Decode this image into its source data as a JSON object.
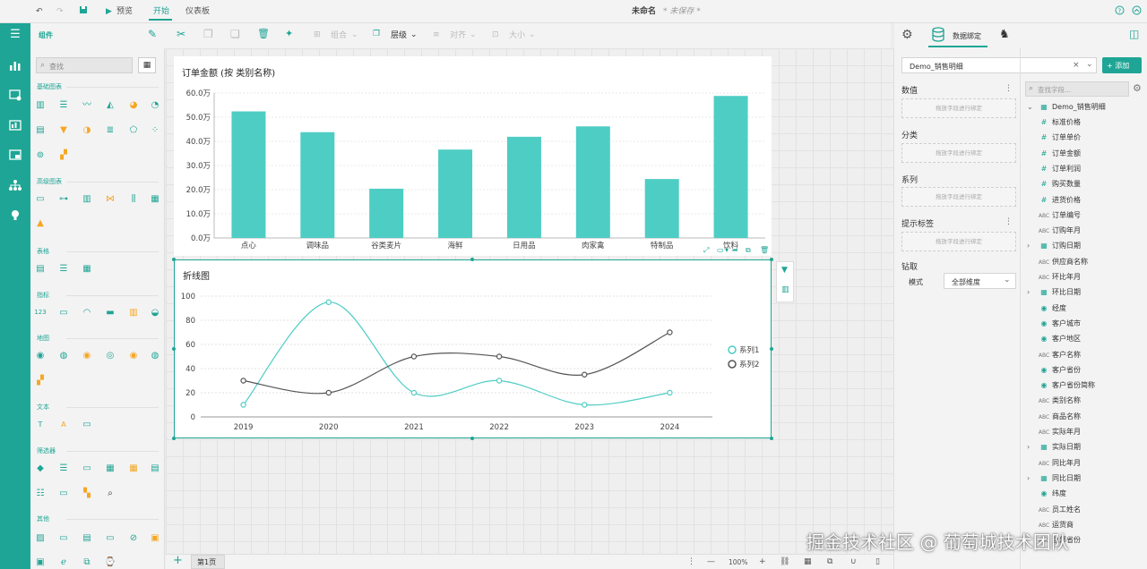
{
  "app": {
    "title": "未命名",
    "save_status": "* 未保存 *",
    "menu": {
      "preview": "预览",
      "start": "开始",
      "dashboard": "仪表板"
    }
  },
  "toolbar": {
    "group": "组合",
    "layer": "层级",
    "align": "对齐",
    "size": "大小"
  },
  "left_panel": {
    "title": "组件",
    "search_placeholder": "查找",
    "sections": {
      "basic": "基础图表",
      "advanced": "高级图表",
      "table": "表格",
      "indicator": "指标",
      "map": "地图",
      "text": "文本",
      "filter": "筛选器",
      "other": "其他"
    }
  },
  "bar_chart": {
    "title": "订单金额 (按 类别名称)",
    "chart_data": {
      "type": "bar",
      "categories": [
        "点心",
        "调味品",
        "谷类麦片",
        "海鲜",
        "日用品",
        "肉家禽",
        "特制品",
        "饮料"
      ],
      "values": [
        52.4,
        43.8,
        20.4,
        36.6,
        41.9,
        46.2,
        24.4,
        58.8
      ],
      "ylim": [
        0,
        60
      ],
      "yticks": [
        0,
        10,
        20,
        30,
        40,
        50,
        60
      ],
      "ytick_labels": [
        "0.0万",
        "10.0万",
        "20.0万",
        "30.0万",
        "40.0万",
        "50.0万",
        "60.0万"
      ],
      "color": "#4ecdc4"
    }
  },
  "line_chart": {
    "title": "折线图",
    "chart_data": {
      "type": "line",
      "categories": [
        "2019",
        "2020",
        "2021",
        "2022",
        "2023",
        "2024"
      ],
      "ylim": [
        0,
        100
      ],
      "yticks": [
        0,
        20,
        40,
        60,
        80,
        100
      ],
      "series": [
        {
          "name": "系列1",
          "values": [
            10,
            95,
            20,
            30,
            10,
            20
          ],
          "color": "#4ecdc4"
        },
        {
          "name": "系列2",
          "values": [
            30,
            20,
            50,
            50,
            35,
            70
          ],
          "color": "#555555"
        }
      ]
    }
  },
  "right_panel": {
    "tab_label": "数据绑定",
    "add_label": "+ 添加",
    "dataset": "Demo_销售明细",
    "field_search_placeholder": "查找字段...",
    "value_label": "数值",
    "category_label": "分类",
    "series_label": "系列",
    "tooltip_label": "提示标签",
    "drop_hint": "拖放字段进行绑定",
    "drill_label": "钻取",
    "mode_label": "模式",
    "mode_value": "全部维度",
    "tree_root": "Demo_销售明细",
    "fields": [
      {
        "label": "标准价格",
        "type": "num",
        "expand": false
      },
      {
        "label": "订单单价",
        "type": "num",
        "expand": false
      },
      {
        "label": "订单金额",
        "type": "num",
        "expand": false
      },
      {
        "label": "订单利润",
        "type": "num",
        "expand": false
      },
      {
        "label": "购买数量",
        "type": "num",
        "expand": false
      },
      {
        "label": "进货价格",
        "type": "num",
        "expand": false
      },
      {
        "label": "订单编号",
        "type": "abc",
        "expand": false
      },
      {
        "label": "订购年月",
        "type": "abc",
        "expand": false
      },
      {
        "label": "订购日期",
        "type": "date",
        "expand": true
      },
      {
        "label": "供应商名称",
        "type": "abc",
        "expand": false
      },
      {
        "label": "环比年月",
        "type": "abc",
        "expand": false
      },
      {
        "label": "环比日期",
        "type": "date",
        "expand": true
      },
      {
        "label": "经度",
        "type": "geo",
        "expand": false
      },
      {
        "label": "客户城市",
        "type": "geo",
        "expand": false
      },
      {
        "label": "客户地区",
        "type": "geo",
        "expand": false
      },
      {
        "label": "客户名称",
        "type": "abc",
        "expand": false
      },
      {
        "label": "客户省份",
        "type": "geo",
        "expand": false
      },
      {
        "label": "客户省份简称",
        "type": "geo",
        "expand": false
      },
      {
        "label": "类别名称",
        "type": "abc",
        "expand": false
      },
      {
        "label": "商品名称",
        "type": "abc",
        "expand": false
      },
      {
        "label": "实际年月",
        "type": "abc",
        "expand": false
      },
      {
        "label": "实际日期",
        "type": "date",
        "expand": true
      },
      {
        "label": "同比年月",
        "type": "abc",
        "expand": false
      },
      {
        "label": "同比日期",
        "type": "date",
        "expand": true
      },
      {
        "label": "纬度",
        "type": "geo",
        "expand": false
      },
      {
        "label": "员工姓名",
        "type": "abc",
        "expand": false
      },
      {
        "label": "运货商",
        "type": "abc",
        "expand": false
      },
      {
        "label": "总部省份",
        "type": "abc",
        "expand": false
      }
    ]
  },
  "bottom": {
    "page_tab": "第1页",
    "zoom": "100%"
  },
  "watermark": "掘金技术社区 @ 葡萄城技术团队",
  "colors": {
    "accent": "#1fa595",
    "bar": "#4ecdc4"
  }
}
